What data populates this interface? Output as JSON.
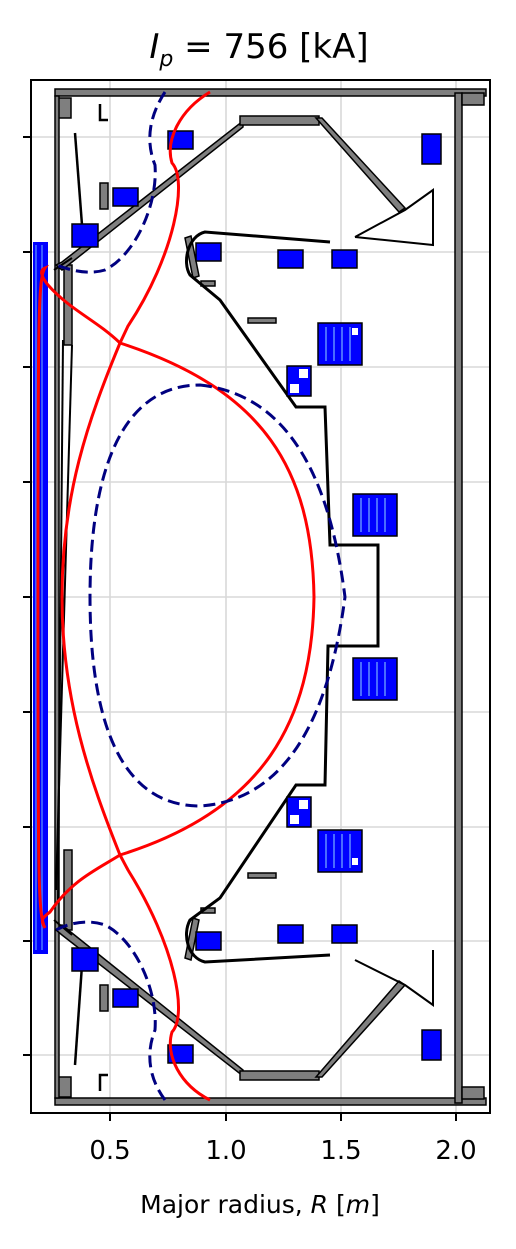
{
  "title": {
    "var": "I",
    "sub": "p",
    "rest": " = 756 [kA]"
  },
  "xaxis": {
    "label_prefix": "Major radius, ",
    "label_var": "R",
    "label_unit_open": " [",
    "label_unit": "m",
    "label_unit_close": "]",
    "ticks": [
      "0.5",
      "1.0",
      "1.5",
      "2.0"
    ],
    "tick_values": [
      0.5,
      1.0,
      1.5,
      2.0
    ],
    "xlim": [
      0.155,
      2.15
    ]
  },
  "yaxis": {
    "tick_count": 9,
    "tick_labels_shown": false
  },
  "colors": {
    "coil": "#0000ff",
    "wall": "#7f7f7f",
    "separatrix": "#ff0000",
    "boundary": "#000080",
    "grid": "#d8d8d8"
  },
  "plasma": {
    "current_kA": 756
  }
}
